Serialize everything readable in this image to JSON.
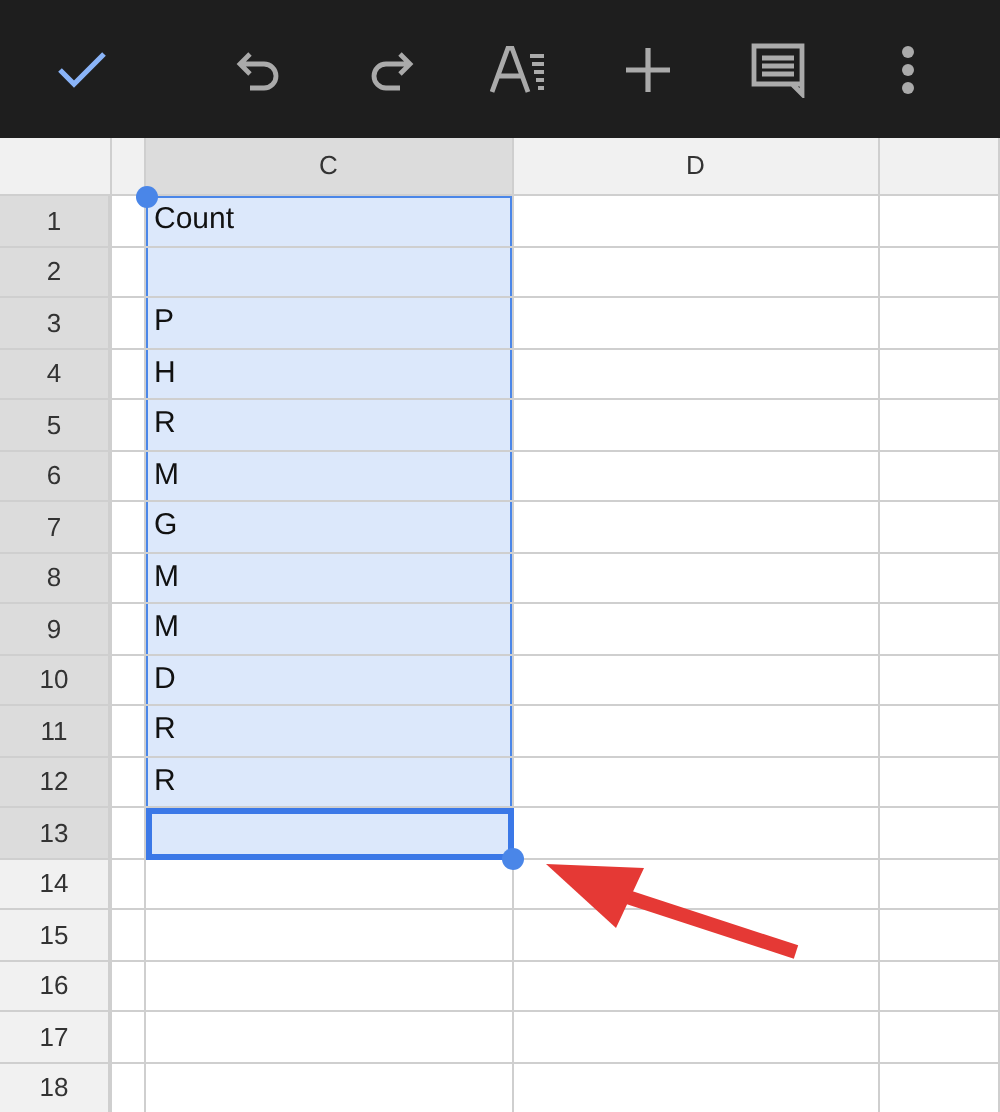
{
  "toolbar": {
    "actions": [
      {
        "kind": "done"
      },
      {
        "kind": "undo"
      },
      {
        "kind": "redo"
      },
      {
        "kind": "format"
      },
      {
        "kind": "insert"
      },
      {
        "kind": "comment"
      },
      {
        "kind": "more"
      }
    ]
  },
  "columns": [
    {
      "kind": "narrow",
      "selected": false
    },
    {
      "kind": "wide",
      "label": "C",
      "selected": true
    },
    {
      "kind": "wide",
      "label": "D",
      "selected": false
    },
    {
      "kind": "partial",
      "selected": false
    }
  ],
  "rows": [
    {
      "number": "1",
      "selected": true,
      "active": false,
      "value": "Count"
    },
    {
      "number": "2",
      "selected": true,
      "active": false
    },
    {
      "number": "3",
      "selected": true,
      "active": false,
      "value": "P"
    },
    {
      "number": "4",
      "selected": true,
      "active": false,
      "value": "H"
    },
    {
      "number": "5",
      "selected": true,
      "active": false,
      "value": "R"
    },
    {
      "number": "6",
      "selected": true,
      "active": false,
      "value": "M"
    },
    {
      "number": "7",
      "selected": true,
      "active": false,
      "value": "G"
    },
    {
      "number": "8",
      "selected": true,
      "active": false,
      "value": "M"
    },
    {
      "number": "9",
      "selected": true,
      "active": false,
      "value": "M"
    },
    {
      "number": "10",
      "selected": true,
      "active": false,
      "value": "D"
    },
    {
      "number": "11",
      "selected": true,
      "active": false,
      "value": "R"
    },
    {
      "number": "12",
      "selected": true,
      "active": false,
      "value": "R"
    },
    {
      "number": "13",
      "selected": true,
      "active": true
    },
    {
      "number": "14",
      "selected": false,
      "active": false
    },
    {
      "number": "15",
      "selected": false,
      "active": false
    },
    {
      "number": "16",
      "selected": false,
      "active": false
    },
    {
      "number": "17",
      "selected": false,
      "active": false
    },
    {
      "number": "18",
      "selected": false,
      "active": false
    }
  ],
  "annotation": {
    "kind": "arrow"
  }
}
